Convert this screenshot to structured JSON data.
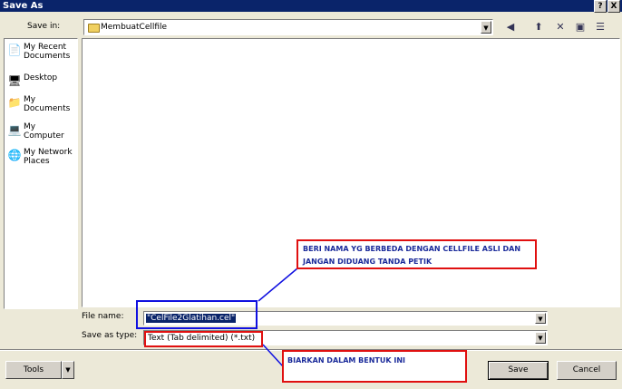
{
  "window": {
    "title": "Save As",
    "help_btn": "?",
    "close_btn": "X"
  },
  "savein": {
    "label": "Save in:",
    "folder": "MembuatCellfile"
  },
  "places": [
    {
      "label": "My Recent Documents",
      "icon": "recent-documents-icon"
    },
    {
      "label": "Desktop",
      "icon": "desktop-icon"
    },
    {
      "label": "My Documents",
      "icon": "my-documents-icon"
    },
    {
      "label": "My Computer",
      "icon": "my-computer-icon"
    },
    {
      "label": "My Network Places",
      "icon": "network-places-icon"
    }
  ],
  "filename": {
    "label": "File name:",
    "value": "\"CelFile2Glatihan.cel\""
  },
  "savetype": {
    "label": "Save as type:",
    "value": "Text (Tab delimited) (*.txt)"
  },
  "buttons": {
    "tools": "Tools",
    "save": "Save",
    "cancel": "Cancel"
  },
  "annotations": {
    "note1": "BERI NAMA YG BERBEDA DENGAN CELLFILE ASLI DAN JANGAN DIDUANG TANDA PETIK",
    "note2": "BIARKAN DALAM BENTUK INI"
  },
  "colors": {
    "annotation_red": "#e01010",
    "annotation_blue": "#1010e0",
    "titlebar": "#0a246a"
  }
}
